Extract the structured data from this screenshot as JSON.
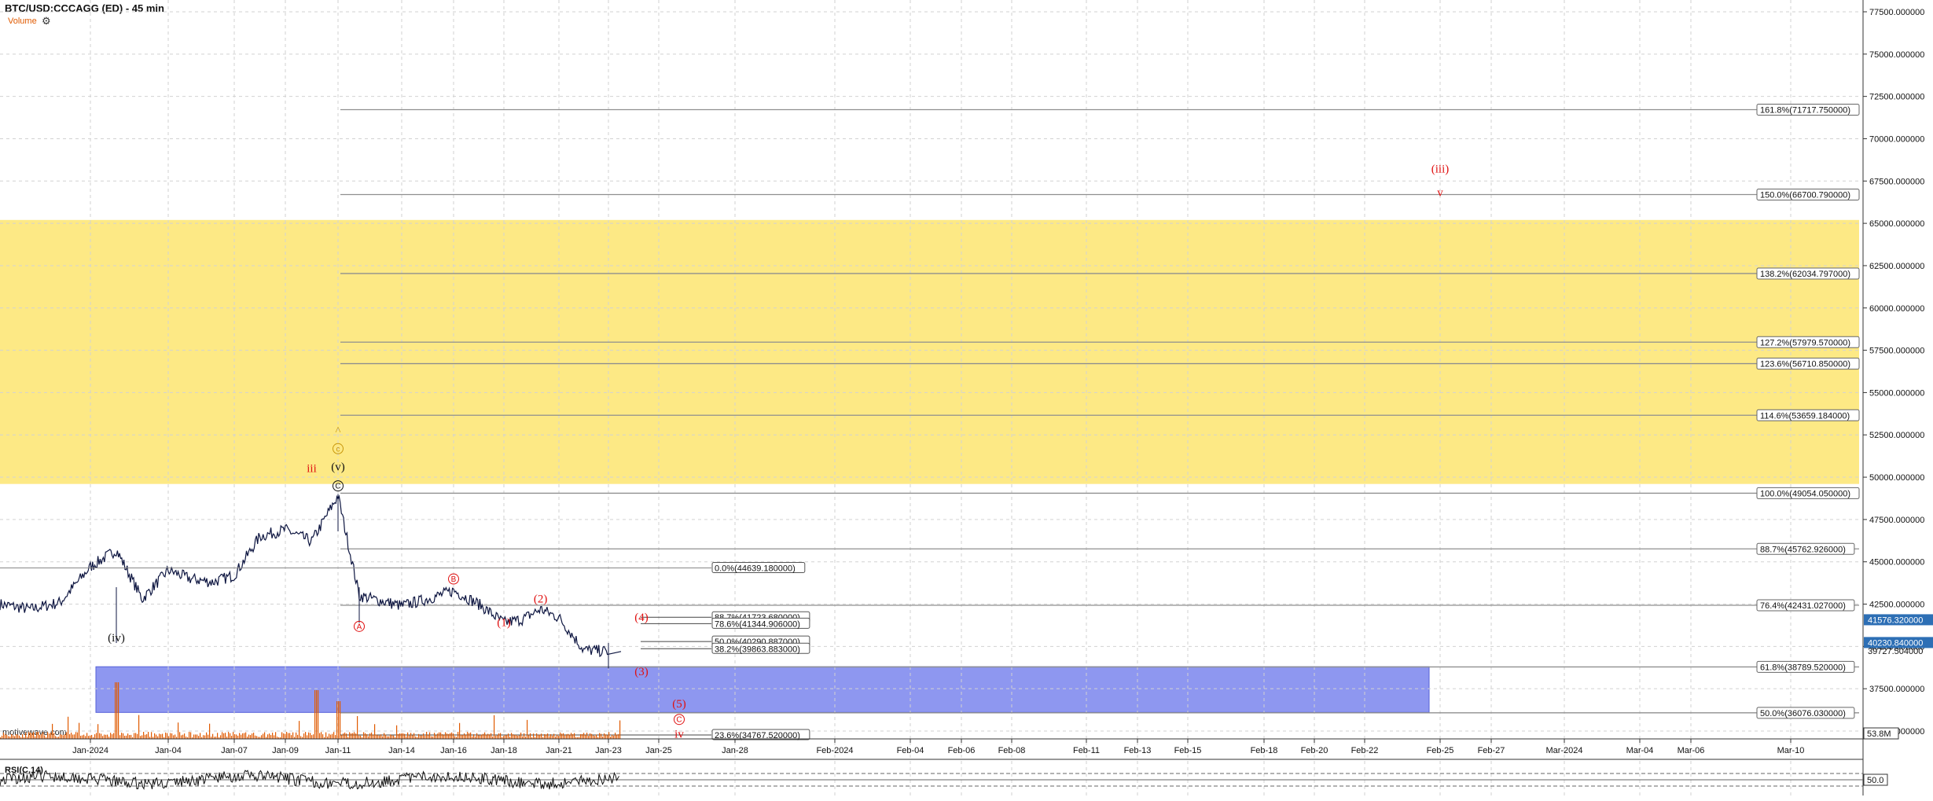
{
  "header": {
    "title": "BTC/USD:CCCAGG (ED) - 45 min",
    "volume_label": "Volume",
    "settings_icon": "gear-icon"
  },
  "watermark": "motivewave.com",
  "rsi": {
    "label": "RSI(C,14)",
    "level": "50.0"
  },
  "colors": {
    "yellow_zone": "#fde985",
    "blue_zone": "#8e97f0",
    "fib_line": "#8f8f8f",
    "wave_red": "#e01010",
    "wave_black": "#111111",
    "wave_gold": "#c8960a",
    "price_badge": "#2d6fb5",
    "volume": "#e05a00"
  },
  "chart_data": {
    "type": "line",
    "title": "BTC/USD:CCCAGG (ED) - 45 min",
    "xlabel": "",
    "ylabel": "",
    "ylim": [
      33600,
      78000
    ],
    "x_ticks": [
      "Jan-2024",
      "Jan-04",
      "Jan-07",
      "Jan-09",
      "Jan-11",
      "Jan-14",
      "Jan-16",
      "Jan-18",
      "Jan-21",
      "Jan-23",
      "Jan-25",
      "Jan-28",
      "Feb-2024",
      "Feb-04",
      "Feb-06",
      "Feb-08",
      "Feb-11",
      "Feb-13",
      "Feb-15",
      "Feb-18",
      "Feb-20",
      "Feb-22",
      "Feb-25",
      "Feb-27",
      "Mar-2024",
      "Mar-04",
      "Mar-06",
      "Mar-10"
    ],
    "y_ticks": [
      "77500.000000",
      "75000.000000",
      "72500.000000",
      "70000.000000",
      "67500.000000",
      "65000.000000",
      "62500.000000",
      "60000.000000",
      "57500.000000",
      "55000.000000",
      "52500.000000",
      "50000.000000",
      "47500.000000",
      "45000.000000",
      "42500.000000",
      "40000.000000",
      "37500.000000",
      "35000.000000"
    ],
    "price_series": {
      "name": "BTC/USD",
      "x": [
        "Dec-29",
        "Dec-30",
        "Dec-31",
        "Jan-01",
        "Jan-02",
        "Jan-03",
        "Jan-04",
        "Jan-05",
        "Jan-06",
        "Jan-07",
        "Jan-08",
        "Jan-09",
        "Jan-10",
        "Jan-11",
        "Jan-12",
        "Jan-13",
        "Jan-14",
        "Jan-15",
        "Jan-16",
        "Jan-17",
        "Jan-18",
        "Jan-19",
        "Jan-20",
        "Jan-21",
        "Jan-22",
        "Jan-23"
      ],
      "values": [
        42500,
        42200,
        42600,
        44700,
        45700,
        42800,
        44500,
        44000,
        43800,
        44200,
        46500,
        46900,
        46200,
        48900,
        43000,
        42700,
        42400,
        42800,
        43300,
        42500,
        41400,
        41600,
        42200,
        41700,
        39800,
        39700
      ]
    },
    "last_price": "39727.504000",
    "current_labels": [
      "41576.320000",
      "40230.840000"
    ],
    "volume_total": "53.8M",
    "fib_extension_lines": [
      {
        "label": "161.8%(71717.750000)",
        "value": 71717.75
      },
      {
        "label": "150.0%(66700.790000)",
        "value": 66700.79
      },
      {
        "label": "138.2%(62034.797000)",
        "value": 62034.797
      },
      {
        "label": "127.2%(57979.570000)",
        "value": 57979.57
      },
      {
        "label": "123.6%(56710.850000)",
        "value": 56710.85
      },
      {
        "label": "114.6%(53659.184000)",
        "value": 53659.184
      },
      {
        "label": "100.0%(49054.050000)",
        "value": 49054.05
      },
      {
        "label": "88.7%(45762.926000)",
        "value": 45762.926
      },
      {
        "label": "76.4%(42431.027000)",
        "value": 42431.027
      },
      {
        "label": "61.8%(38789.520000)",
        "value": 38789.52
      },
      {
        "label": "50.0%(36076.030000)",
        "value": 36076.03
      }
    ],
    "fib_retracement_lines": [
      {
        "label": "0.0%(44639.180000)",
        "value": 44639.18
      },
      {
        "label": "88.7%(41723.680000)",
        "value": 41723.68
      },
      {
        "label": "78.6%(41344.906000)",
        "value": 41344.906
      },
      {
        "label": "50.0%(40290.887000)",
        "value": 40290.887
      },
      {
        "label": "38.2%(39863.883000)",
        "value": 39863.883
      },
      {
        "label": "23.6%(34767.520000)",
        "value": 34767.52
      }
    ],
    "zones": [
      {
        "name": "yellow",
        "from": 49600,
        "to": 65200
      },
      {
        "name": "blue",
        "from": 36100,
        "to": 38800
      }
    ],
    "wave_labels": [
      {
        "text": "iii",
        "x": "Jan-10",
        "value": 50300,
        "color": "red"
      },
      {
        "text": "^",
        "x": "Jan-11",
        "value": 52500,
        "color": "gold"
      },
      {
        "text": "c",
        "x": "Jan-11",
        "value": 51500,
        "color": "gold"
      },
      {
        "text": "(v)",
        "x": "Jan-11",
        "value": 50400,
        "color": "black"
      },
      {
        "text": "C",
        "x": "Jan-11",
        "value": 49300,
        "color": "black"
      },
      {
        "text": "(iv)",
        "x": "Jan-02",
        "value": 40300,
        "color": "black"
      },
      {
        "text": "A",
        "x": "Jan-12",
        "value": 41000,
        "color": "red"
      },
      {
        "text": "B",
        "x": "Jan-16",
        "value": 43800,
        "color": "red"
      },
      {
        "text": "(1)",
        "x": "Jan-18",
        "value": 41200,
        "color": "red"
      },
      {
        "text": "(2)",
        "x": "Jan-20",
        "value": 42600,
        "color": "red"
      },
      {
        "text": "(4)",
        "x": "Jan-23",
        "value": 41500,
        "color": "red"
      },
      {
        "text": "(3)",
        "x": "Jan-23",
        "value": 38300,
        "color": "red"
      },
      {
        "text": "(5)",
        "x": "Jan-24",
        "value": 36400,
        "color": "red"
      },
      {
        "text": "C",
        "x": "Jan-24",
        "value": 35500,
        "color": "red"
      },
      {
        "text": "iv",
        "x": "Jan-24",
        "value": 34600,
        "color": "red"
      },
      {
        "text": "(iii)",
        "x": "Feb-25",
        "value": 68000,
        "color": "red"
      },
      {
        "text": "v",
        "x": "Feb-25",
        "value": 66600,
        "color": "red"
      }
    ],
    "rsi_level": 50.0,
    "grid": true,
    "legend": "none"
  }
}
